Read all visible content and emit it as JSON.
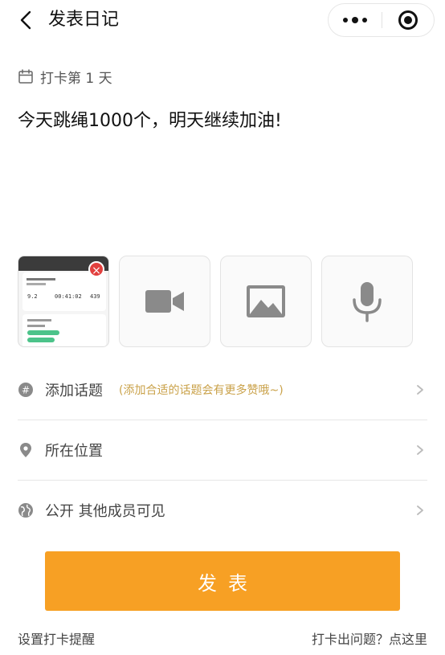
{
  "header": {
    "title": "发表日记",
    "back_icon": "chevron-left-icon",
    "more_icon": "more-dots-icon",
    "close_icon": "target-icon"
  },
  "checkin": {
    "icon": "calendar-icon",
    "text": "打卡第 1 天"
  },
  "content": {
    "text": "今天跳绳1000个，明天继续加油!"
  },
  "media": {
    "thumbnail": {
      "stat_1": "9.2",
      "stat_2": "00:41:02",
      "stat_3": "439",
      "delete_icon": "close-icon",
      "delete_glyph": "×"
    },
    "tiles": [
      {
        "icon": "video-camera-icon"
      },
      {
        "icon": "image-icon"
      },
      {
        "icon": "microphone-icon"
      }
    ]
  },
  "options": [
    {
      "icon": "hashtag-icon",
      "label": "添加话题",
      "hint": "(添加合适的话题会有更多赞哦~)"
    },
    {
      "icon": "location-pin-icon",
      "label": "所在位置",
      "hint": ""
    },
    {
      "icon": "globe-icon",
      "label": "公开 其他成员可见",
      "hint": ""
    }
  ],
  "publish_button": {
    "label": "发表",
    "color": "#f7a024"
  },
  "footer": {
    "left_link": "设置打卡提醒",
    "right_link": "打卡出问题？点这里"
  },
  "colors": {
    "accent": "#f7a024",
    "hint": "#caa24a",
    "delete": "#e2403e"
  }
}
